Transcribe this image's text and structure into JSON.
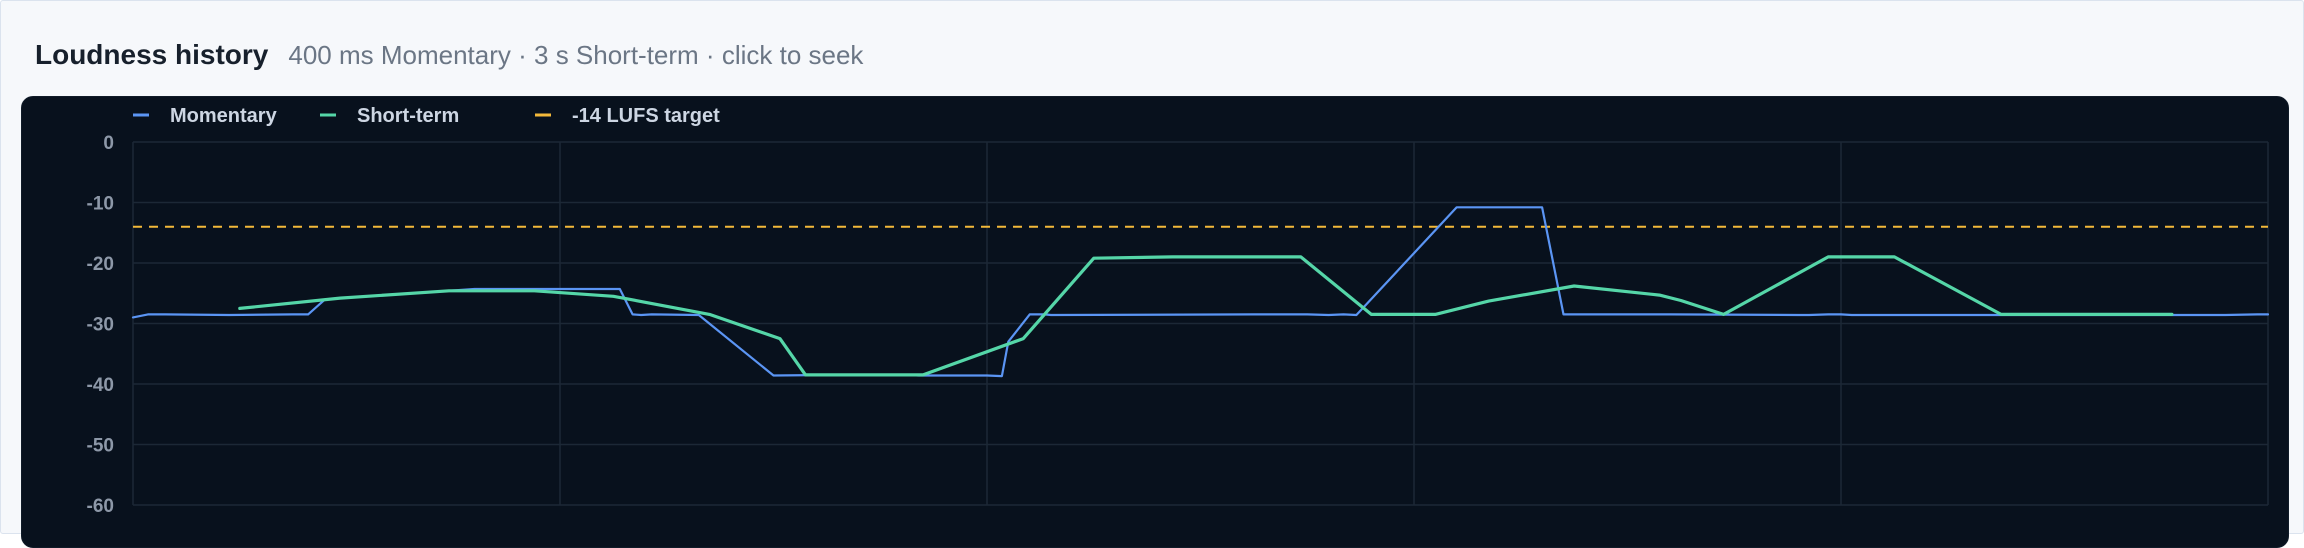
{
  "header": {
    "title": "Loudness history",
    "subtitle": "400 ms Momentary · 3 s Short-term · click to seek"
  },
  "colors": {
    "momentary": "#5b95f4",
    "short_term": "#55d6a8",
    "target": "#f3b93a",
    "grid": "#1c2836",
    "plot_bg": "#08111d"
  },
  "chart_data": {
    "type": "line",
    "title": "Loudness history",
    "xlabel": "",
    "ylabel": "",
    "xlim": [
      0,
      100
    ],
    "ylim": [
      -60,
      0
    ],
    "yticks": [
      0,
      -10,
      -20,
      -30,
      -40,
      -50,
      -60
    ],
    "ytick_labels": [
      "0",
      "-10",
      "-20",
      "-30",
      "-40",
      "-50",
      "-60"
    ],
    "x_gridlines": [
      0,
      20,
      40,
      60,
      80,
      100
    ],
    "grid": true,
    "legend_position": "top-left",
    "series": [
      {
        "name": "Momentary",
        "x": [
          0,
          0.7,
          1.5,
          4.5,
          7.5,
          8.2,
          9.0,
          16.0,
          17.5,
          18.4,
          20.0,
          22.0,
          22.8,
          23.4,
          23.8,
          24.3,
          26.5,
          30.0,
          33.0,
          35.9,
          36.2,
          36.8,
          37.5,
          40.0,
          40.7,
          41.0,
          42.0,
          42.7,
          43.0,
          52.5,
          55.0,
          56.0,
          56.7,
          57.3,
          62.0,
          66.0,
          67.0,
          67.8,
          72.0,
          78.0,
          78.5,
          79.4,
          80.0,
          80.5,
          91.0,
          98.0,
          99.5,
          100
        ],
        "y": [
          -29,
          -28.5,
          -28.5,
          -28.6,
          -28.5,
          -28.5,
          -26,
          -24.3,
          -24.3,
          -24.3,
          -24.3,
          -24.3,
          -24.3,
          -28.5,
          -28.6,
          -28.5,
          -28.6,
          -38.6,
          -38.5,
          -38.5,
          -38.5,
          -38.6,
          -38.6,
          -38.6,
          -38.7,
          -33,
          -28.5,
          -28.5,
          -28.6,
          -28.5,
          -28.5,
          -28.6,
          -28.5,
          -28.6,
          -10.8,
          -10.8,
          -28.5,
          -28.5,
          -28.5,
          -28.6,
          -28.6,
          -28.5,
          -28.5,
          -28.6,
          -28.6,
          -28.6,
          -28.5,
          -28.5
        ],
        "source_note": "momentary values read off the chart"
      },
      {
        "name": "Short-term",
        "x": [
          5.0,
          9.7,
          14.8,
          18.8,
          22.5,
          27.0,
          30.3,
          31.5,
          37.0,
          41.7,
          45.0,
          48.7,
          54.7,
          58.0,
          61.0,
          63.5,
          67.5,
          71.5,
          72.5,
          74.5,
          79.4,
          82.5,
          87.5,
          91.0,
          94.5,
          95.5
        ],
        "y": [
          -27.5,
          -25.8,
          -24.6,
          -24.6,
          -25.5,
          -28.5,
          -32.5,
          -38.5,
          -38.5,
          -32.5,
          -19.2,
          -19.0,
          -19.0,
          -28.5,
          -28.5,
          -26.3,
          -23.8,
          -25.3,
          -26.2,
          -28.5,
          -19.0,
          -19.0,
          -28.5,
          -28.5,
          -28.5,
          -28.5
        ]
      }
    ],
    "reference_lines": [
      {
        "name": "-14 LUFS target",
        "y": -14
      }
    ]
  },
  "legend": {
    "momentary_label": "Momentary",
    "short_term_label": "Short-term",
    "target_label": "-14 LUFS target"
  }
}
